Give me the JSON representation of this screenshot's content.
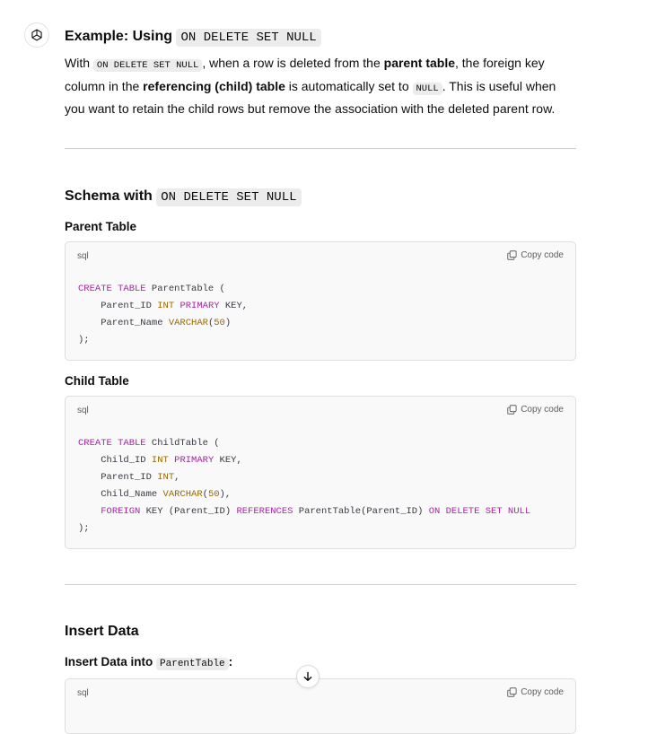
{
  "section1": {
    "title_prefix": "Example: Using",
    "title_code": "ON DELETE SET NULL",
    "p_with": "With",
    "p_code1": "ON DELETE SET NULL",
    "p_t1": ", when a row is deleted from the",
    "p_b1": "parent table",
    "p_t2": ", the foreign key column in the",
    "p_b2": "referencing (child) table",
    "p_t3": "is automatically set to",
    "p_code2": "NULL",
    "p_t4": ". This is useful when you want to retain the child rows but remove the association with the deleted parent row."
  },
  "section2": {
    "title_prefix": "Schema with",
    "title_code": "ON DELETE SET NULL",
    "parent_label": "Parent Table",
    "child_label": "Child Table"
  },
  "section3": {
    "title": "Insert Data",
    "label_prefix": "Insert Data into",
    "label_code": "ParentTable",
    "label_suffix": ":"
  },
  "code_block": {
    "lang": "sql",
    "copy_label": "Copy code"
  },
  "parent_code": [
    [
      {
        "t": "CREATE TABLE",
        "c": "kw"
      },
      {
        "t": " ParentTable ("
      }
    ],
    [
      {
        "t": "    Parent_ID "
      },
      {
        "t": "INT",
        "c": "ty"
      },
      {
        "t": " "
      },
      {
        "t": "PRIMARY",
        "c": "kw"
      },
      {
        "t": " KEY,"
      }
    ],
    [
      {
        "t": "    Parent_Name "
      },
      {
        "t": "VARCHAR",
        "c": "ty"
      },
      {
        "t": "("
      },
      {
        "t": "50",
        "c": "num"
      },
      {
        "t": ")"
      }
    ],
    [
      {
        "t": ");"
      }
    ]
  ],
  "child_code": [
    [
      {
        "t": "CREATE TABLE",
        "c": "kw"
      },
      {
        "t": " ChildTable ("
      }
    ],
    [
      {
        "t": "    Child_ID "
      },
      {
        "t": "INT",
        "c": "ty"
      },
      {
        "t": " "
      },
      {
        "t": "PRIMARY",
        "c": "kw"
      },
      {
        "t": " KEY,"
      }
    ],
    [
      {
        "t": "    Parent_ID "
      },
      {
        "t": "INT",
        "c": "ty"
      },
      {
        "t": ","
      }
    ],
    [
      {
        "t": "    Child_Name "
      },
      {
        "t": "VARCHAR",
        "c": "ty"
      },
      {
        "t": "("
      },
      {
        "t": "50",
        "c": "num"
      },
      {
        "t": "),"
      }
    ],
    [
      {
        "t": "    "
      },
      {
        "t": "FOREIGN",
        "c": "kw"
      },
      {
        "t": " KEY (Parent_ID) "
      },
      {
        "t": "REFERENCES",
        "c": "kw"
      },
      {
        "t": " ParentTable(Parent_ID) "
      },
      {
        "t": "ON DELETE SET NULL",
        "c": "kw"
      }
    ],
    [
      {
        "t": ");"
      }
    ]
  ],
  "icons": {
    "assistant": "openai-logo-icon",
    "copy": "copy-icon",
    "scroll": "arrow-down-icon"
  }
}
